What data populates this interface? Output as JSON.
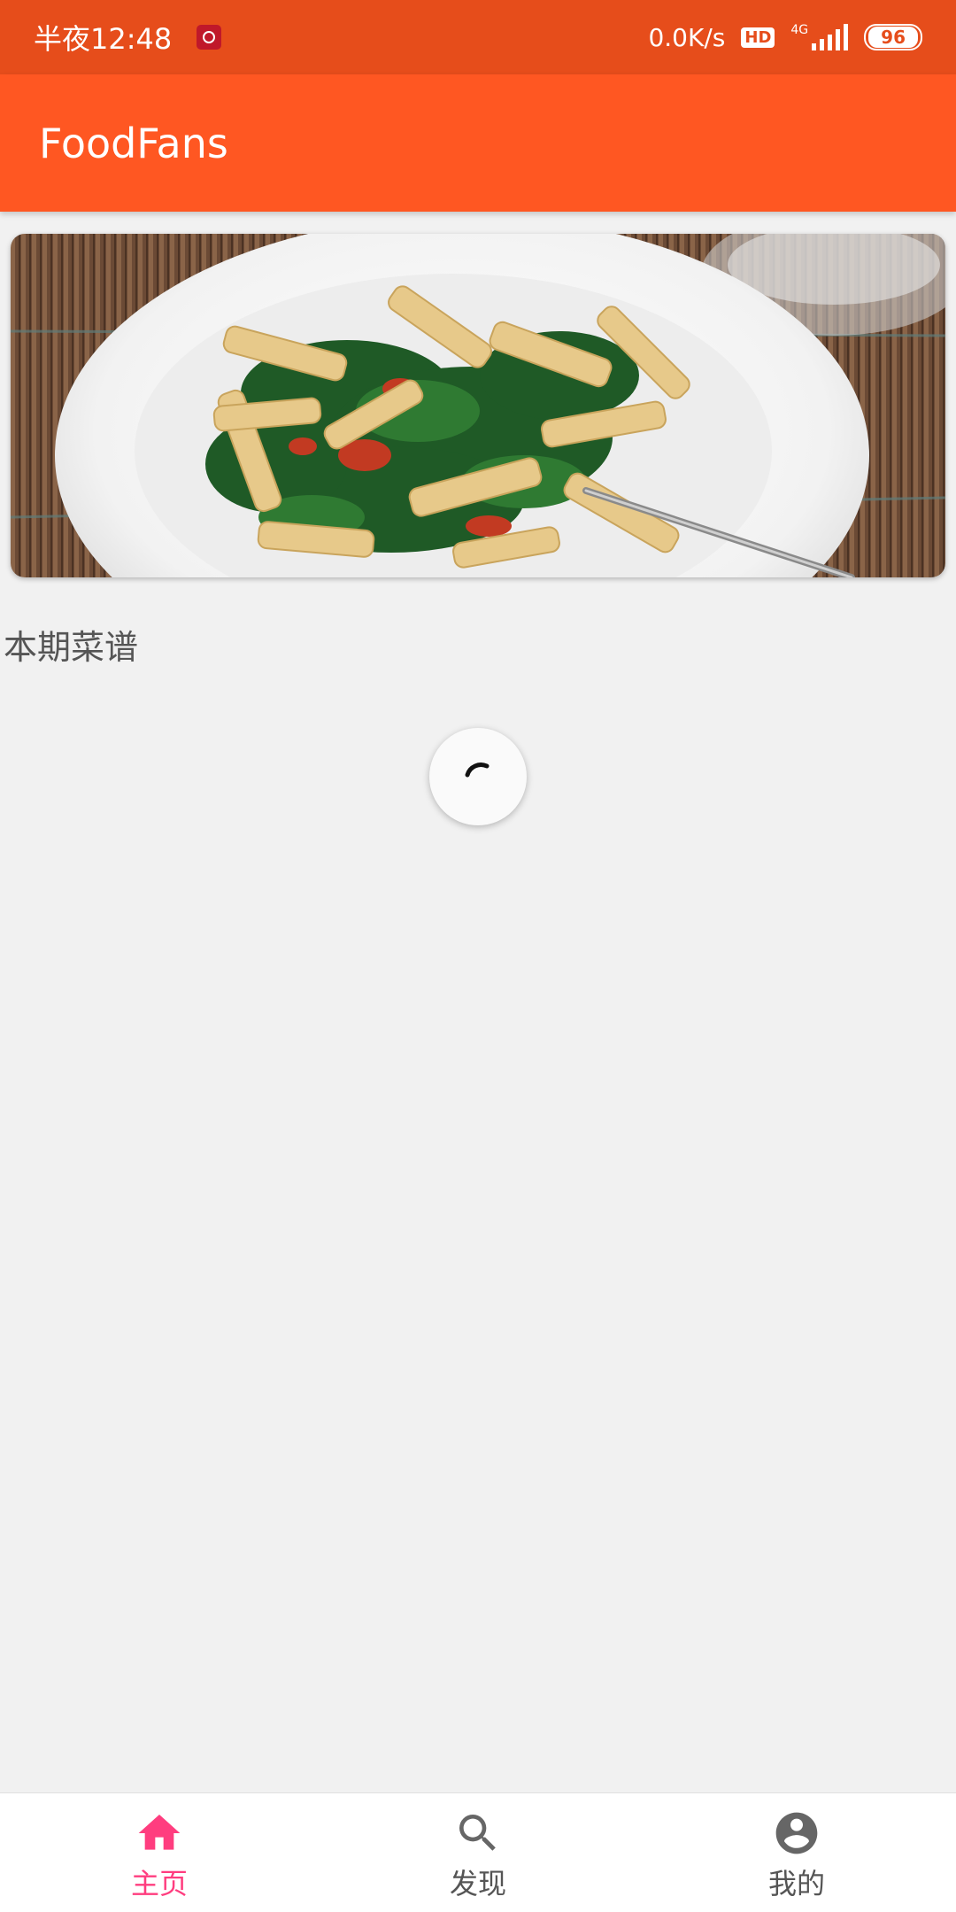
{
  "status_bar": {
    "time": "半夜12:48",
    "network_speed": "0.0K/s",
    "hd_badge": "HD",
    "network_type": "4G",
    "battery": "96"
  },
  "app_bar": {
    "title": "FoodFans"
  },
  "banner": {
    "image_icon": "pasta-dish-photo"
  },
  "section": {
    "title": "本期菜谱"
  },
  "loading": {
    "icon": "loading-spinner-icon"
  },
  "bottom_nav": {
    "items": [
      {
        "label": "主页",
        "icon": "home-icon",
        "active": true
      },
      {
        "label": "发现",
        "icon": "search-icon",
        "active": false
      },
      {
        "label": "我的",
        "icon": "account-icon",
        "active": false
      }
    ],
    "active_color": "#ff3d7f",
    "inactive_color": "#555555"
  },
  "colors": {
    "status_bar": "#e64d1b",
    "app_bar": "#ff5722",
    "background": "#f1f1f1"
  }
}
